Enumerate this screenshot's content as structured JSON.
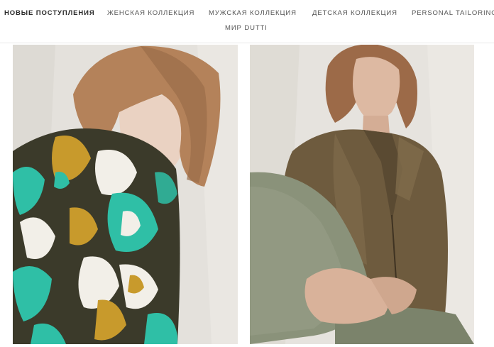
{
  "nav": {
    "items": [
      {
        "label": "НОВЫЕ ПОСТУПЛЕНИЯ"
      },
      {
        "label": "ЖЕНСКАЯ КОЛЛЕКЦИЯ"
      },
      {
        "label": "МУЖСКАЯ КОЛЛЕКЦИЯ"
      },
      {
        "label": "ДЕТСКАЯ КОЛЛЕКЦИЯ"
      },
      {
        "label": "PERSONAL TAILORING"
      },
      {
        "label": "МИР DUTTI"
      }
    ]
  },
  "products": [
    {
      "image": "woman-in-floral-print-blouse",
      "palette": {
        "background": "#e4e1dc",
        "print_dark": "#3b3a2a",
        "print_teal": "#2fbfa6",
        "print_mustard": "#c89a2c",
        "print_white": "#f2efe8",
        "hair": "#b4825a",
        "skin": "#ead2c2"
      }
    },
    {
      "image": "woman-in-leather-jacket",
      "palette": {
        "background": "#e6e3de",
        "jacket": "#6e5b3e",
        "trousers": "#8a927a",
        "hair": "#9c6a48",
        "skin": "#ddb9a2"
      }
    }
  ]
}
